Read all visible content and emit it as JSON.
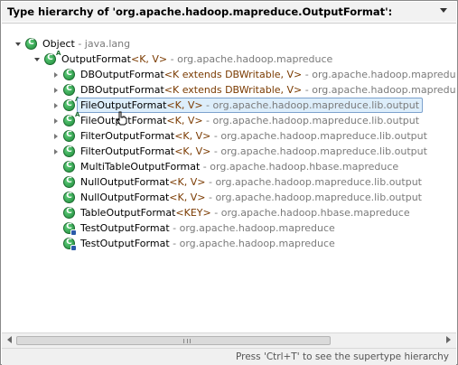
{
  "header": {
    "title": "Type hierarchy of 'org.apache.hadoop.mapreduce.OutputFormat':"
  },
  "tree": [
    {
      "name": "Object",
      "type_params": "",
      "package": "java.lang",
      "expand": "expanded",
      "icon": "class-icon"
    },
    {
      "name": "OutputFormat",
      "type_params": "<K, V>",
      "package": "org.apache.hadoop.mapreduce",
      "expand": "expanded",
      "icon": "abstract-class-icon"
    },
    {
      "name": "DBOutputFormat",
      "type_params": "<K extends DBWritable, V>",
      "package": "org.apache.hadoop.mapreduce.lib.d",
      "expand": "collapsed",
      "icon": "class-icon"
    },
    {
      "name": "DBOutputFormat",
      "type_params": "<K extends DBWritable, V>",
      "package": "org.apache.hadoop.mapreduce.lib.d",
      "expand": "collapsed",
      "icon": "class-icon"
    },
    {
      "name": "FileOutputFormat",
      "type_params": "<K, V>",
      "package": "org.apache.hadoop.mapreduce.lib.output",
      "expand": "collapsed",
      "icon": "abstract-class-icon",
      "selected": true
    },
    {
      "name": "FileOutputFormat",
      "type_params": "<K, V>",
      "package": "org.apache.hadoop.mapreduce.lib.output",
      "expand": "collapsed",
      "icon": "abstract-class-icon"
    },
    {
      "name": "FilterOutputFormat",
      "type_params": "<K, V>",
      "package": "org.apache.hadoop.mapreduce.lib.output",
      "expand": "collapsed",
      "icon": "class-icon"
    },
    {
      "name": "FilterOutputFormat",
      "type_params": "<K, V>",
      "package": "org.apache.hadoop.mapreduce.lib.output",
      "expand": "collapsed",
      "icon": "class-icon"
    },
    {
      "name": "MultiTableOutputFormat",
      "type_params": "",
      "package": "org.apache.hadoop.hbase.mapreduce",
      "expand": "none",
      "icon": "class-icon"
    },
    {
      "name": "NullOutputFormat",
      "type_params": "<K, V>",
      "package": "org.apache.hadoop.mapreduce.lib.output",
      "expand": "none",
      "icon": "class-icon"
    },
    {
      "name": "NullOutputFormat",
      "type_params": "<K, V>",
      "package": "org.apache.hadoop.mapreduce.lib.output",
      "expand": "none",
      "icon": "class-icon"
    },
    {
      "name": "TableOutputFormat",
      "type_params": "<KEY>",
      "package": "org.apache.hadoop.hbase.mapreduce",
      "expand": "none",
      "icon": "class-icon"
    },
    {
      "name": "TestOutputFormat",
      "type_params": "",
      "package": "org.apache.hadoop.mapreduce",
      "expand": "none",
      "icon": "test-class-icon"
    },
    {
      "name": "TestOutputFormat",
      "type_params": "",
      "package": "org.apache.hadoop.mapreduce",
      "expand": "none",
      "icon": "test-class-icon"
    }
  ],
  "package_separator": " - ",
  "status_bar": {
    "hint": "Press 'Ctrl+T' to see the supertype hierarchy"
  },
  "colors": {
    "selection_bg": "#ddeefb",
    "selection_border": "#7da2ce",
    "class_icon": "#1f8a3b",
    "type_param_text": "#7a3a00",
    "package_text": "#7a7a7a"
  }
}
